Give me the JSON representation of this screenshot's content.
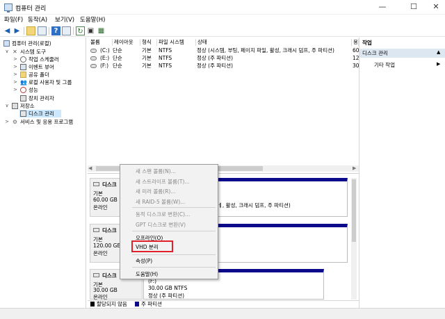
{
  "window": {
    "title": "컴퓨터 관리",
    "minimize": "—",
    "maximize": "☐",
    "close": "✕"
  },
  "menu": [
    "파일(F)",
    "동작(A)",
    "보기(V)",
    "도움말(H)"
  ],
  "tree": {
    "root": "컴퓨터 관리(로컬)",
    "system_tools": "시스템 도구",
    "task_scheduler": "작업 스케줄러",
    "event_viewer": "이벤트 뷰어",
    "shared_folders": "공유 폴더",
    "local_users": "로컬 사용자 및 그룹",
    "performance": "성능",
    "device_manager": "장치 관리자",
    "storage": "저장소",
    "disk_management": "디스크 관리",
    "services": "서비스 및 응용 프로그램"
  },
  "list": {
    "columns": [
      "볼륨",
      "레이아웃",
      "형식",
      "파일 시스템",
      "상태",
      "용"
    ],
    "rows": [
      {
        "volume": "(C:)",
        "layout": "단순",
        "type": "기본",
        "fs": "NTFS",
        "status": "정상 (시스템, 부팅, 페이지 파일, 활성, 크래시 덤프, 주 파티션)",
        "cap": "60"
      },
      {
        "volume": "(E:)",
        "layout": "단순",
        "type": "기본",
        "fs": "NTFS",
        "status": "정상 (주 파티션)",
        "cap": "12"
      },
      {
        "volume": "(F:)",
        "layout": "단순",
        "type": "기본",
        "fs": "NTFS",
        "status": "정상 (주 파티션)",
        "cap": "30"
      }
    ]
  },
  "disks": [
    {
      "name": "디스크",
      "type": "기본",
      "size": "60.00 GB",
      "state": "온라인",
      "part_status": "ㅔ, 활성, 크래시 덤프, 주 파티션)"
    },
    {
      "name": "디스크",
      "type": "기본",
      "size": "120.00 GB",
      "state": "온라인"
    },
    {
      "name": "디스크",
      "type": "기본",
      "size": "30.00 GB",
      "state": "온라인",
      "part_label": "(F:)",
      "part_size": "30.00 GB NTFS",
      "part_status": "정상 (주 파티션)"
    }
  ],
  "legend": {
    "unallocated": "할당되지 않음",
    "primary": "주 파티션"
  },
  "context_menu": {
    "new_spanned": "새 스팬 볼륨(N)...",
    "new_striped": "새 스트라이프 볼륨(T)...",
    "new_mirrored": "새 미러 볼륨(R)...",
    "new_raid5": "새 RAID-5 볼륨(W)...",
    "convert_dynamic": "동적 디스크로 변환(C)...",
    "convert_gpt": "GPT 디스크로 변환(V)",
    "offline": "오프라인(O)",
    "detach_vhd": "VHD 분리",
    "properties": "속성(P)",
    "help": "도움말(H)"
  },
  "actions": {
    "header": "작업",
    "group": "디스크 관리",
    "more": "기타 작업"
  },
  "colors": {
    "primary_partition": "#0a0a8a",
    "highlight": "#e0202a"
  }
}
